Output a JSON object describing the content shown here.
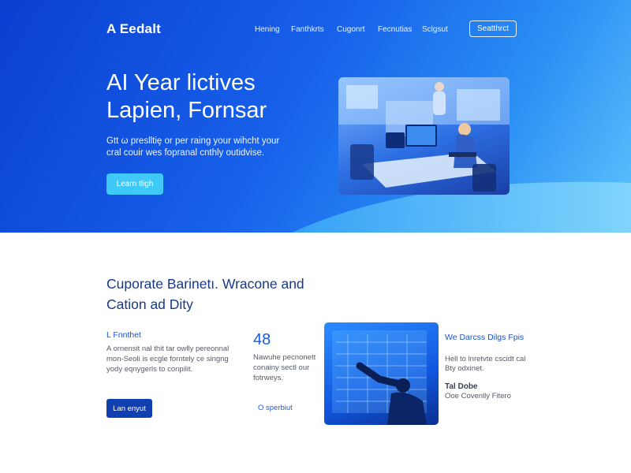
{
  "header": {
    "brand": "A Eedalt",
    "nav": [
      "Hening",
      "Fanthkrts",
      "Cugonrt",
      "Fecnutias",
      "Sclgsut"
    ],
    "cta": "Seatthrct"
  },
  "hero": {
    "title": "AI Year lictives Lapien, Fornsar",
    "subtitle": "Gtt ω preslltiȩ or per raing your wihcht your cral couir wes fopranal cnthly outidvise.",
    "button": "Learn tligh"
  },
  "section": {
    "title": "Cuporate Barinetı. Wracone and Cation ad Dity",
    "feature": {
      "heading": "L Fnnthet",
      "text": "A ornensit nal thit tar owlly pereonnal mon-Seoli is ecgle forntely ce singng yody eqnygerls to conpilit.",
      "button": "Lan enyut"
    },
    "stat": {
      "number": "48",
      "text": "Nawuhe pecnonett conainy sectl our fotrweys.",
      "link": "O sperbiut"
    },
    "side": {
      "heading": "We Darcss Dilgs Fpis",
      "text": "Hell to lnretvte cscidt cal Bty odxinet.",
      "subheading": "Tal Dobe",
      "subtext": "Ooe Covenlly Fitero"
    }
  },
  "colors": {
    "hero_gradient_start": "#0a3fd0",
    "hero_gradient_end": "#5fc4fb",
    "accent_button": "#3fc9f6",
    "primary_button": "#0f3fb0",
    "heading_blue": "#163a8a",
    "link_blue": "#1a5be0"
  },
  "images": {
    "hero_photo": "office-workers-at-computers-photo",
    "panel_photo": "person-touching-holographic-screen-photo"
  }
}
